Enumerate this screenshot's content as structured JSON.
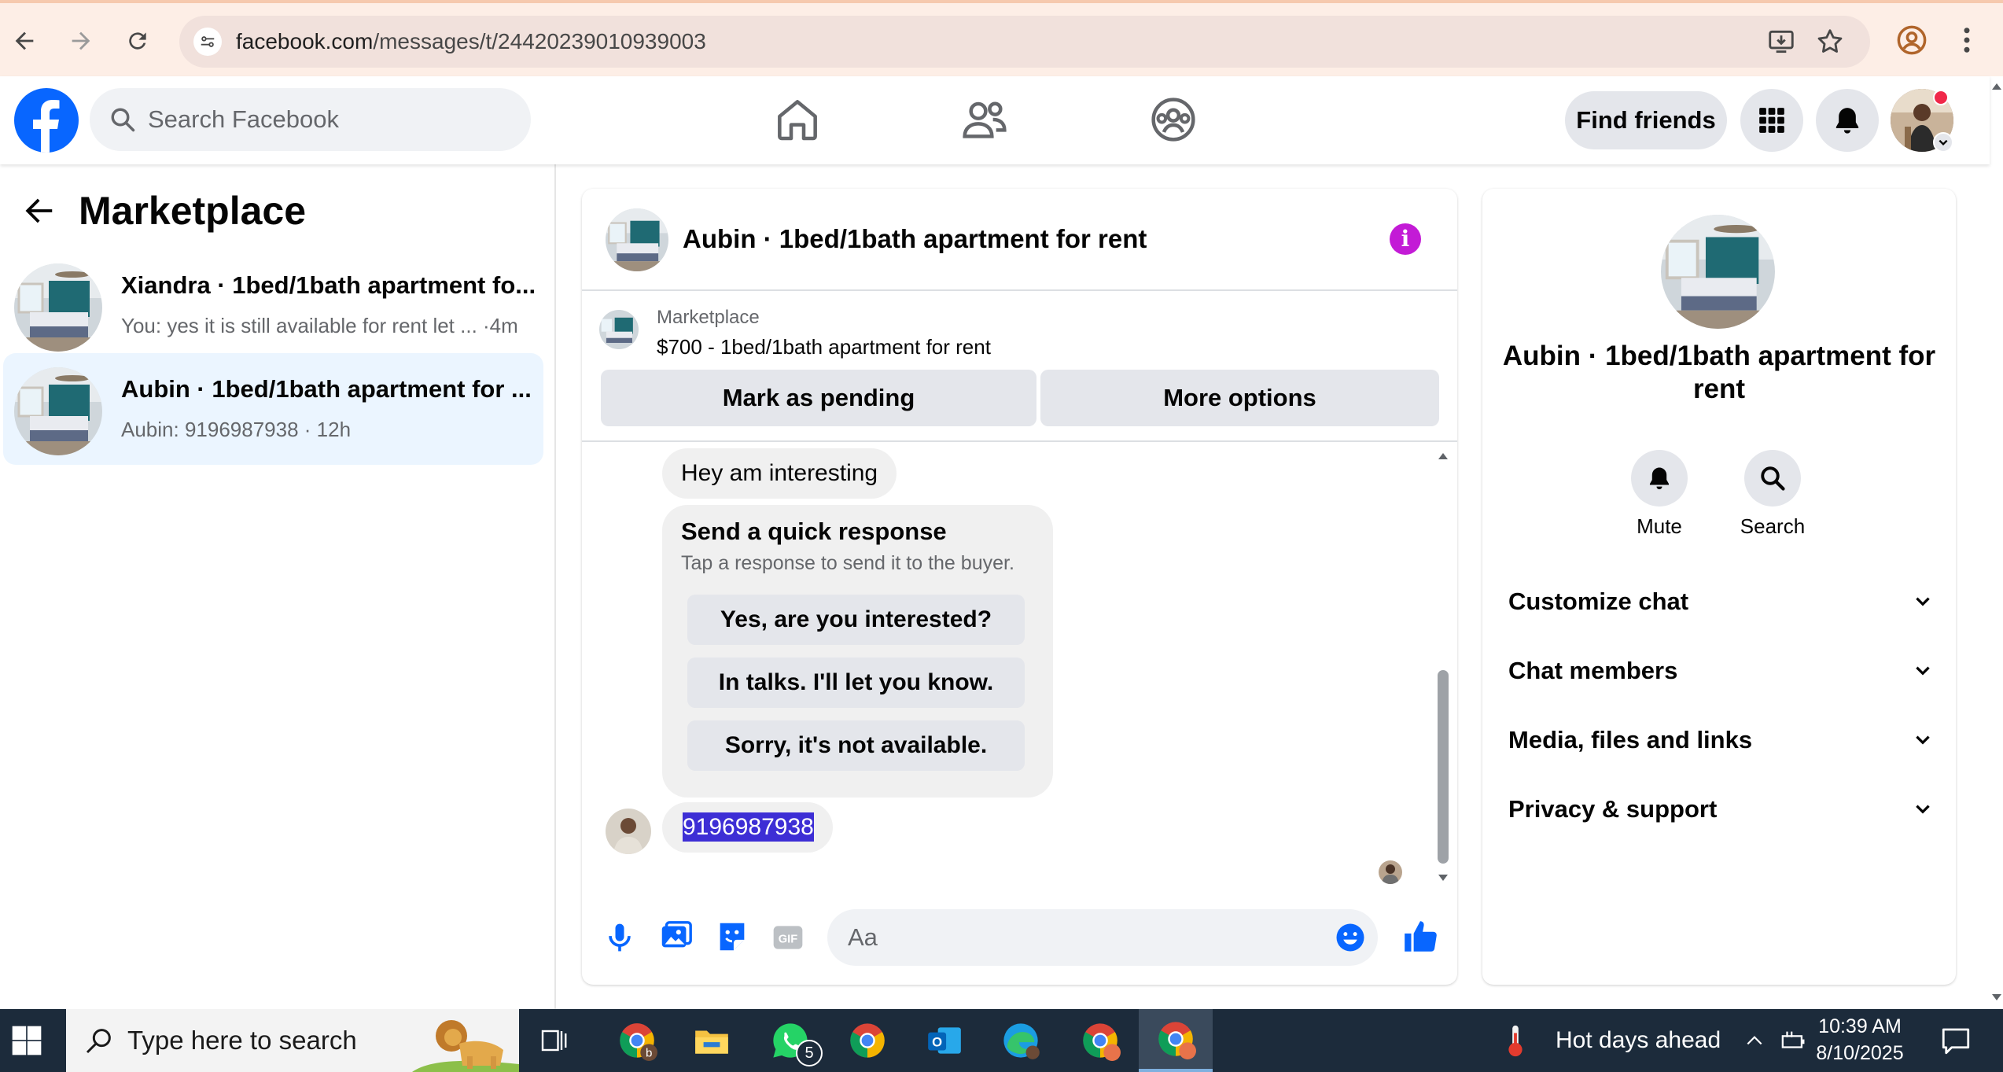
{
  "browser": {
    "url_host": "facebook.com",
    "url_path": "/messages/t/24420239010939003",
    "icons": [
      "back-arrow-icon",
      "forward-arrow-icon",
      "reload-icon",
      "site-info-icon",
      "install-app-icon",
      "bookmark-star-icon",
      "profile-icon",
      "kebab-menu-icon"
    ]
  },
  "header": {
    "search_placeholder": "Search Facebook",
    "find_friends": "Find friends",
    "nav_icons": [
      "home-icon",
      "friends-icon",
      "groups-icon"
    ]
  },
  "sidebar": {
    "title": "Marketplace",
    "threads": [
      {
        "title": "Xiandra · 1bed/1bath apartment fo...",
        "preview": "You: yes it is still available for rent let ... ·4m",
        "active": false
      },
      {
        "title": "Aubin · 1bed/1bath apartment for ...",
        "preview": "Aubin: 9196987938 · 12h",
        "active": true
      }
    ]
  },
  "chat": {
    "title": "Aubin · 1bed/1bath apartment for rent",
    "listing": {
      "label": "Marketplace",
      "price_title": "$700 - 1bed/1bath apartment for rent",
      "mark_pending": "Mark as pending",
      "more_options": "More options"
    },
    "messages": {
      "incoming_1": "Hey am interesting",
      "quick_title": "Send a quick response",
      "quick_sub": "Tap a response to send it to the buyer.",
      "quick_options": [
        "Yes, are you interested?",
        "In talks. I'll let you know.",
        "Sorry, it's not available."
      ],
      "incoming_2": "9196987938"
    },
    "composer_placeholder": "Aa"
  },
  "details": {
    "title": "Aubin · 1bed/1bath apartment for rent",
    "mute": "Mute",
    "search": "Search",
    "sections": [
      "Customize chat",
      "Chat members",
      "Media, files and links",
      "Privacy & support"
    ]
  },
  "taskbar": {
    "search_placeholder": "Type here to search",
    "whatsapp_badge": "5",
    "weather": "Hot days ahead",
    "time": "10:39 AM",
    "date": "8/10/2025"
  },
  "colors": {
    "fb_blue": "#0866ff",
    "active_thread_bg": "#ebf5ff",
    "selection": "#3d2ed5",
    "info_purple": "#c31bd6"
  }
}
